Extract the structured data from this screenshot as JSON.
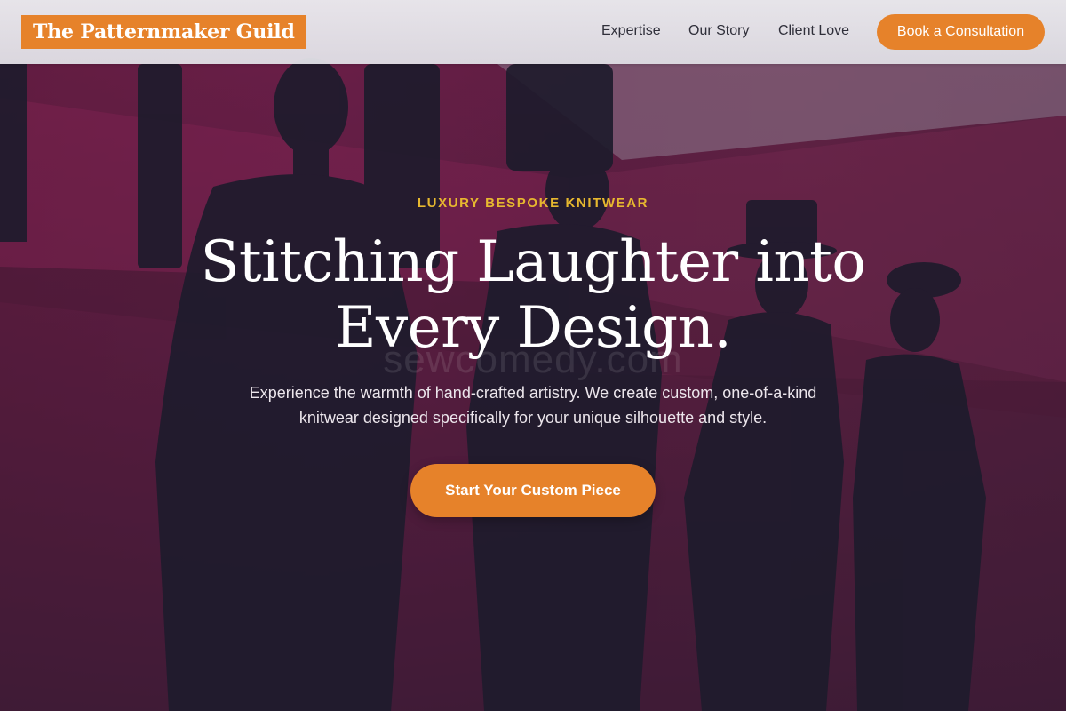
{
  "brand": {
    "name": "The Patternmaker Guild"
  },
  "nav": {
    "links": [
      "Expertise",
      "Our Story",
      "Client Love"
    ],
    "cta_label": "Book a Consultation"
  },
  "hero": {
    "eyebrow": "LUXURY BESPOKE KNITWEAR",
    "headline_line1": "Stitching Laughter into",
    "headline_line2": "Every Design.",
    "watermark": "sewcomedy.com",
    "subtext": "Experience the warmth of hand-crafted artistry. We create custom, one-of-a-kind knitwear designed specifically for your unique silhouette and style.",
    "cta_label": "Start Your Custom Piece"
  },
  "colors": {
    "accent": "#e6822a",
    "eyebrow": "#e7b82f",
    "background": "#6e1d44"
  }
}
